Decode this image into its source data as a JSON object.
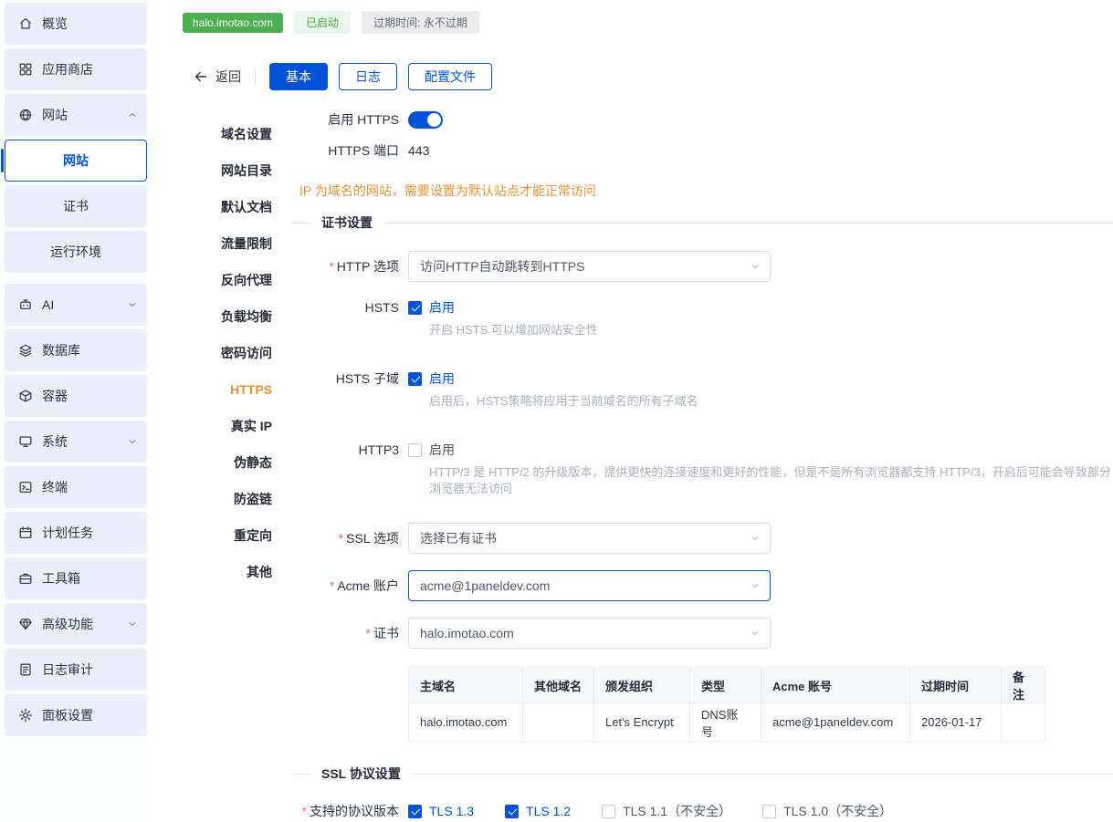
{
  "colors": {
    "primary": "#0052d9",
    "site_badge_green": "#4cb050",
    "warning_orange": "#e89135",
    "required_red": "#f56c6c"
  },
  "header": {
    "site_badge": "halo.imotao.com",
    "status_badge": "已启动",
    "expiry_badge": "过期时间: 永不过期"
  },
  "toolbar": {
    "back_label": "返回",
    "tab_basic": "基本",
    "tab_log": "日志",
    "tab_config": "配置文件"
  },
  "sidebar": {
    "items": [
      {
        "label": "概览",
        "icon": "home-icon"
      },
      {
        "label": "应用商店",
        "icon": "appstore-icon"
      },
      {
        "label": "网站",
        "icon": "globe-icon"
      },
      {
        "label": "AI",
        "icon": "ai-icon"
      },
      {
        "label": "数据库",
        "icon": "database-icon"
      },
      {
        "label": "容器",
        "icon": "container-icon"
      },
      {
        "label": "系统",
        "icon": "system-icon"
      },
      {
        "label": "终端",
        "icon": "terminal-icon"
      },
      {
        "label": "计划任务",
        "icon": "cron-icon"
      },
      {
        "label": "工具箱",
        "icon": "toolbox-icon"
      },
      {
        "label": "高级功能",
        "icon": "advanced-icon"
      },
      {
        "label": "日志审计",
        "icon": "logs-icon"
      },
      {
        "label": "面板设置",
        "icon": "settings-icon"
      }
    ],
    "submenu": [
      {
        "label": "网站"
      },
      {
        "label": "证书"
      },
      {
        "label": "运行环境"
      }
    ]
  },
  "anchor_nav": {
    "items": [
      "域名设置",
      "网站目录",
      "默认文档",
      "流量限制",
      "反向代理",
      "负载均衡",
      "密码访问",
      "HTTPS",
      "真实 IP",
      "伪静态",
      "防盗链",
      "重定向",
      "其他"
    ]
  },
  "form": {
    "required_mark": "*",
    "https_enable_label": "启用 HTTPS",
    "https_port_label": "HTTPS 端口",
    "https_port_value": "443",
    "warning": "IP 为域名的网站，需要设置为默认站点才能正常访问",
    "cert_section_title": "证书设置",
    "http_option_label": "HTTP 选项",
    "http_option_value": "访问HTTP自动跳转到HTTPS",
    "hsts_label": "HSTS",
    "enable_label": "启用",
    "hsts_help": "开启 HSTS 可以增加网站安全性",
    "hsts_sub_label": "HSTS 子域",
    "hsts_sub_help": "启用后，HSTS策略将应用于当前域名的所有子域名",
    "http3_label": "HTTP3",
    "http3_help": "HTTP/3 是 HTTP/2 的升级版本，提供更快的连接速度和更好的性能，但是不是所有浏览器都支持 HTTP/3，开启后可能会导致部分浏览器无法访问",
    "ssl_option_label": "SSL 选项",
    "ssl_option_value": "选择已有证书",
    "acme_label": "Acme 账户",
    "acme_value": "acme@1paneldev.com",
    "cert_label": "证书",
    "cert_value": "halo.imotao.com",
    "ssl_protocol_section_title": "SSL 协议设置",
    "protocol_label": "支持的协议版本",
    "protocols": [
      {
        "label": "TLS 1.3",
        "checked": true
      },
      {
        "label": "TLS 1.2",
        "checked": true
      },
      {
        "label": "TLS 1.1（不安全）",
        "checked": false
      },
      {
        "label": "TLS 1.0（不安全）",
        "checked": false
      }
    ]
  },
  "table": {
    "headers": [
      "主域名",
      "其他域名",
      "颁发组织",
      "类型",
      "Acme 账号",
      "过期时间",
      "备注"
    ],
    "row": [
      "halo.imotao.com",
      "",
      "Let's Encrypt",
      "DNS账号",
      "acme@1paneldev.com",
      "2026-01-17",
      ""
    ]
  }
}
